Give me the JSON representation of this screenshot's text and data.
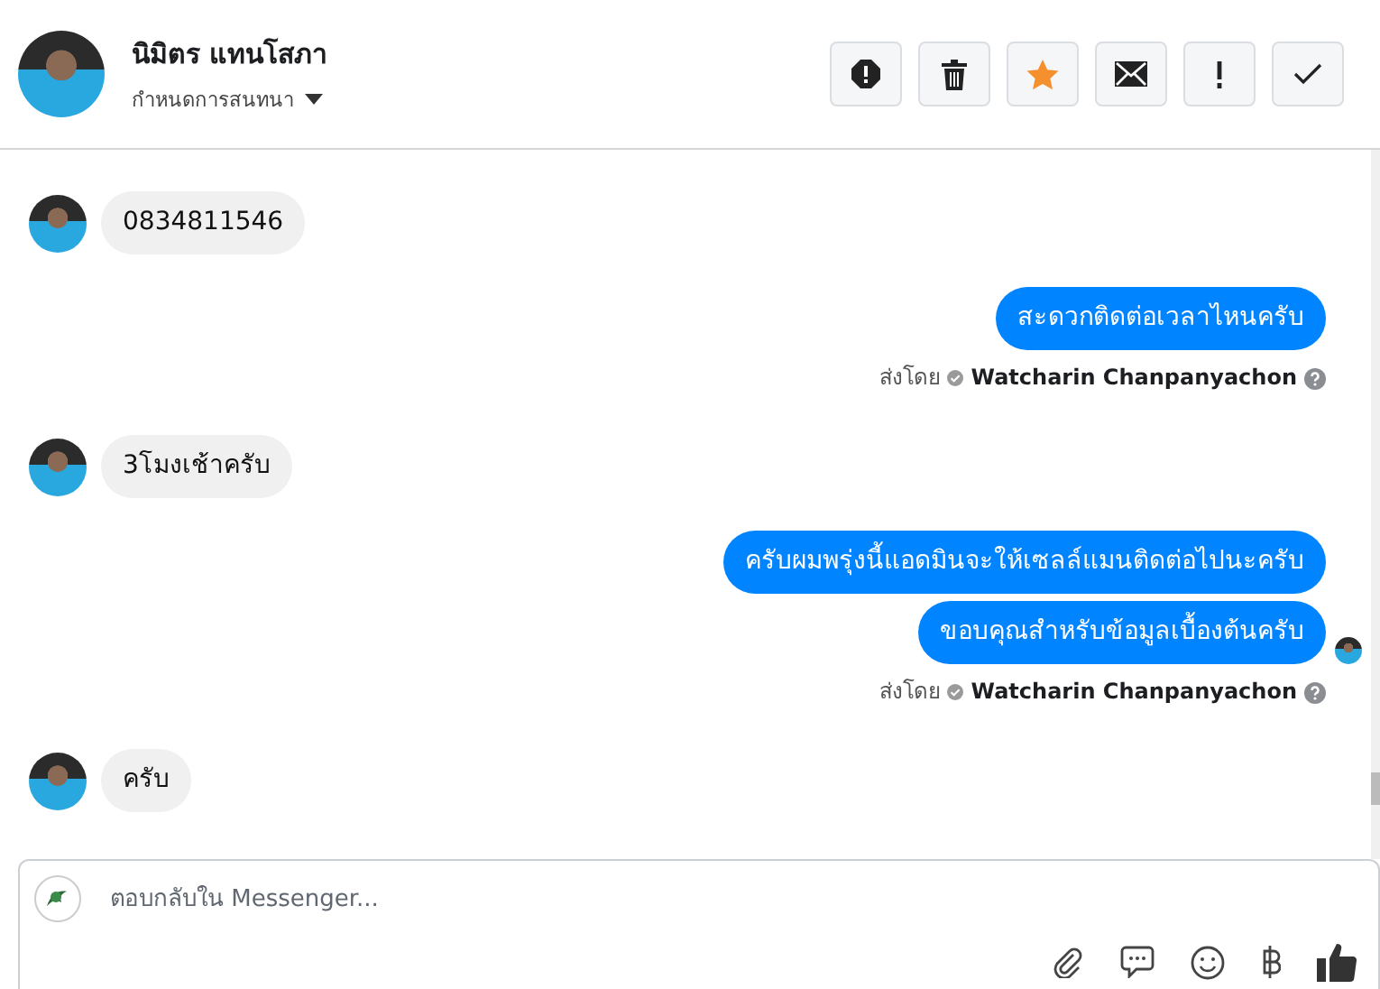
{
  "header": {
    "name": "นิมิตร แทนโสภา",
    "subtitle": "กำหนดการสนทนา"
  },
  "messages": [
    {
      "kind": "incoming",
      "text": "0834811546"
    },
    {
      "kind": "outgoing",
      "text": "สะดวกติดต่อเวลาไหนครับ",
      "seen": false
    },
    {
      "kind": "sent_by",
      "label": "ส่งโดย",
      "name": "Watcharin Chanpanyachon"
    },
    {
      "kind": "incoming",
      "text": "3โมงเช้าครับ"
    },
    {
      "kind": "outgoing",
      "text": "ครับผมพรุ่งนี้แอดมินจะให้เซลล์แมนติดต่อไปนะครับ",
      "seen": false
    },
    {
      "kind": "outgoing",
      "text": "ขอบคุณสำหรับข้อมูลเบื้องต้นครับ",
      "seen": true
    },
    {
      "kind": "sent_by",
      "label": "ส่งโดย",
      "name": "Watcharin Chanpanyachon"
    },
    {
      "kind": "incoming",
      "text": "ครับ"
    }
  ],
  "composer": {
    "placeholder": "ตอบกลับใน Messenger..."
  }
}
